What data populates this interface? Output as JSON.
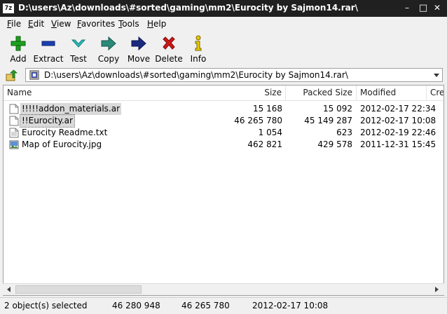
{
  "window": {
    "app_icon_text": "7z",
    "title": "D:\\users\\Az\\downloads\\#sorted\\gaming\\mm2\\Eurocity by Sajmon14.rar\\",
    "controls": {
      "minimize": "–",
      "maximize": "□",
      "close": "✕"
    }
  },
  "menu": [
    {
      "label": "File",
      "accel": "F",
      "rest": "ile"
    },
    {
      "label": "Edit",
      "accel": "E",
      "rest": "dit"
    },
    {
      "label": "View",
      "accel": "V",
      "rest": "iew"
    },
    {
      "label": "Favorites",
      "accel": "F",
      "rest": "avorites"
    },
    {
      "label": "Tools",
      "accel": "T",
      "rest": "ools"
    },
    {
      "label": "Help",
      "accel": "H",
      "rest": "elp"
    }
  ],
  "toolbar": {
    "add": "Add",
    "extract": "Extract",
    "test": "Test",
    "copy": "Copy",
    "move": "Move",
    "delete": "Delete",
    "info": "Info"
  },
  "address": {
    "path": "D:\\users\\Az\\downloads\\#sorted\\gaming\\mm2\\Eurocity by Sajmon14.rar\\"
  },
  "columns": {
    "name": "Name",
    "size": "Size",
    "packed": "Packed Size",
    "modified": "Modified",
    "created": "Cre"
  },
  "files": [
    {
      "name": "!!!!!addon_materials.ar",
      "size": "15 168",
      "packed": "15 092",
      "modified": "2012-02-17 22:34",
      "icon": "file-icon"
    },
    {
      "name": "!!Eurocity.ar",
      "size": "46 265 780",
      "packed": "45 149 287",
      "modified": "2012-02-17 10:08",
      "icon": "file-icon"
    },
    {
      "name": "Eurocity Readme.txt",
      "size": "1 054",
      "packed": "623",
      "modified": "2012-02-19 22:46",
      "icon": "text-file-icon"
    },
    {
      "name": "Map of Eurocity.jpg",
      "size": "462 821",
      "packed": "429 578",
      "modified": "2011-12-31 15:45",
      "icon": "image-file-icon"
    }
  ],
  "status": {
    "selected": "2 object(s) selected",
    "total_size": "46 280 948",
    "total_packed": "46 265 780",
    "date": "2012-02-17 10:08"
  },
  "colors": {
    "titlebar": "#202020",
    "selection": "#d9d9d9",
    "add_green": "#1ea01e",
    "extract_blue": "#1b3fb0",
    "test_cyan": "#2cc0c0",
    "copy_teal": "#2a8a7a",
    "move_navy": "#1a2a80",
    "delete_red": "#d01818",
    "info_yellow": "#e8c800"
  }
}
